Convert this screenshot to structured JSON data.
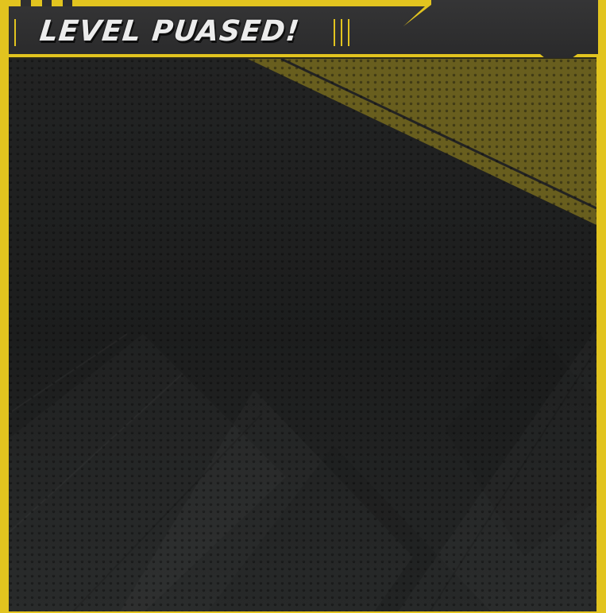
{
  "dialog": {
    "title": "LEVEL PUASED!"
  },
  "colors": {
    "accent": "#e2c41f",
    "panel_dark": "#1c1d1d",
    "header_bg": "#2f2f30",
    "accent_band": "#6f6420"
  },
  "icons": {
    "corner_stripes": "stripes-decoration",
    "divider_lines": "divider-lines-decoration"
  }
}
